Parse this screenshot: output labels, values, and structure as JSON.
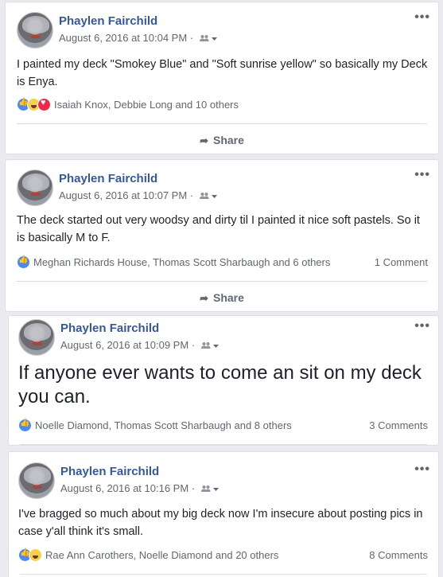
{
  "posts": [
    {
      "author": "Phaylen Fairchild",
      "timestamp": "August 6, 2016 at 10:04 PM",
      "separator": "·",
      "text": "I painted my deck \"Smokey Blue\" and \"Soft sunrise yellow\" so basically my Deck is Enya.",
      "reactions": [
        "like",
        "haha",
        "love"
      ],
      "reaction_names": "Isaiah Knox, Debbie Long and 10 others",
      "comments": "",
      "share_label": "Share"
    },
    {
      "author": "Phaylen Fairchild",
      "timestamp": "August 6, 2016 at 10:07 PM",
      "separator": "·",
      "text": "The deck started out very woodsy and dirty til I painted it nice soft pastels. So it is basically M to F.",
      "reactions": [
        "like"
      ],
      "reaction_names": "Meghan Richards House, Thomas Scott Sharbaugh and 6 others",
      "comments": "1 Comment",
      "share_label": "Share"
    },
    {
      "author": "Phaylen Fairchild",
      "timestamp": "August 6, 2016 at 10:09 PM",
      "separator": "·",
      "text": "If anyone ever wants to come an sit on my deck you can.",
      "reactions": [
        "like"
      ],
      "reaction_names": "Noelle Diamond, Thomas Scott Sharbaugh and 8 others",
      "comments": "3 Comments"
    },
    {
      "author": "Phaylen Fairchild",
      "timestamp": "August 6, 2016 at 10:16 PM",
      "separator": "·",
      "text": "I've bragged so much about my big deck now I'm insecure about posting pics in case y'all think it's small.",
      "reactions": [
        "like",
        "haha"
      ],
      "reaction_names": "Rae Ann Carothers, Noelle Diamond and 20 others",
      "comments": "8 Comments"
    }
  ],
  "more_label": "•••",
  "icons": {
    "audience": "friends-icon",
    "dropdown": "caret-down-icon",
    "share": "share-arrow-icon"
  }
}
